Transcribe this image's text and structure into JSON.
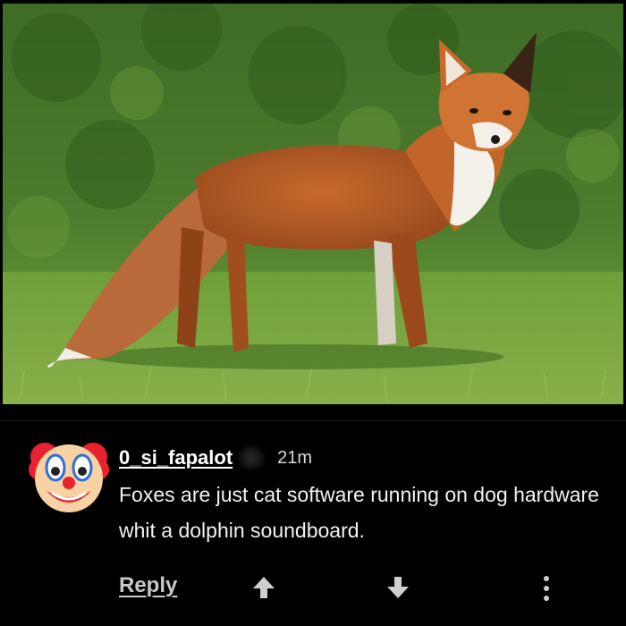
{
  "post": {
    "image_subject": "red-fox-photo"
  },
  "comment": {
    "avatar_icon": "clown-face-icon",
    "username": "0_si_fapalot",
    "timestamp": "21m",
    "body": "Foxes are just cat software running on dog hardware whit a dolphin soundboard.",
    "actions": {
      "reply_label": "Reply",
      "upvote_icon": "arrow-up-icon",
      "downvote_icon": "arrow-down-icon",
      "more_icon": "vertical-ellipsis-icon"
    }
  },
  "colors": {
    "background": "#000000",
    "text": "#f2f2f2",
    "muted": "#c8c8c8"
  }
}
